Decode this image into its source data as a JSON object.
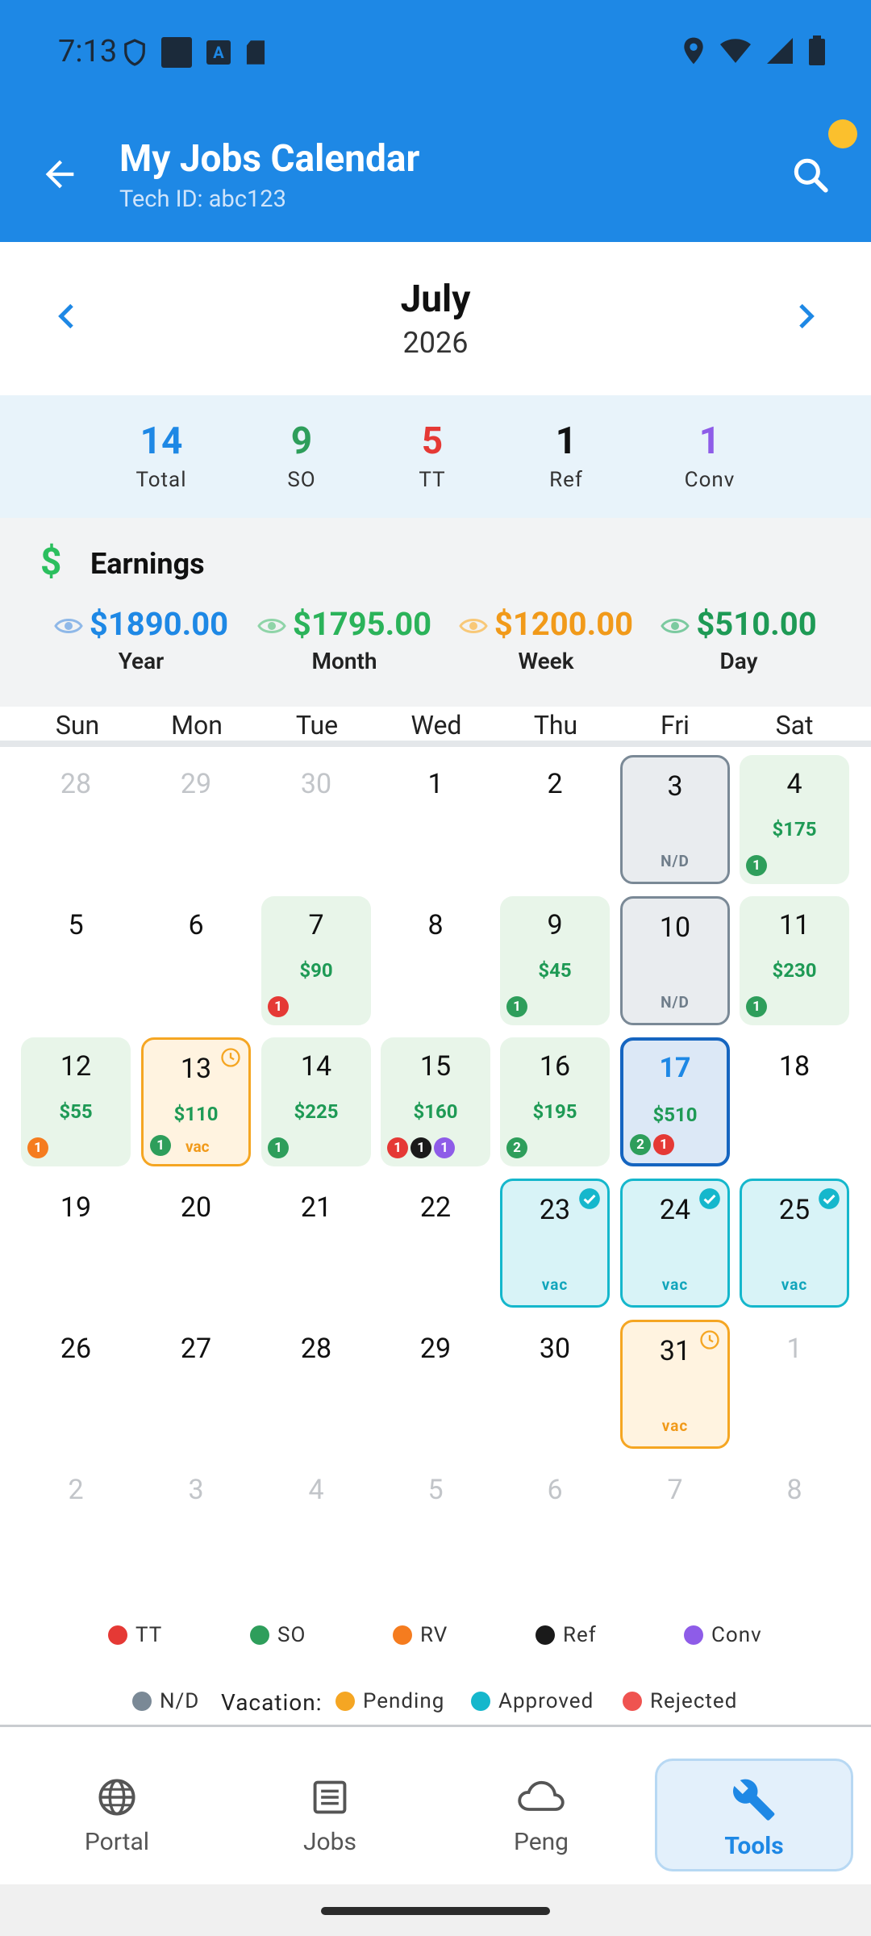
{
  "status_bar": {
    "time": "7:13"
  },
  "app_bar": {
    "title": "My Jobs Calendar",
    "subtitle": "Tech ID: abc123"
  },
  "month_header": {
    "month": "July",
    "year": "2026"
  },
  "stats": [
    {
      "value": "14",
      "label": "Total",
      "color": "#1e88e5"
    },
    {
      "value": "9",
      "label": "SO",
      "color": "#2e9e5b"
    },
    {
      "value": "5",
      "label": "TT",
      "color": "#e53935"
    },
    {
      "value": "1",
      "label": "Ref",
      "color": "#111111"
    },
    {
      "value": "1",
      "label": "Conv",
      "color": "#8e5ce8"
    }
  ],
  "earnings": {
    "title": "Earnings",
    "symbol": "$",
    "items": [
      {
        "amount": "$1890.00",
        "label": "Year",
        "color": "#1e88e5"
      },
      {
        "amount": "$1795.00",
        "label": "Month",
        "color": "#2bb35a"
      },
      {
        "amount": "$1200.00",
        "label": "Week",
        "color": "#f19a1a"
      },
      {
        "amount": "$510.00",
        "label": "Day",
        "color": "#1e9a55"
      }
    ]
  },
  "weekdays": [
    "Sun",
    "Mon",
    "Tue",
    "Wed",
    "Thu",
    "Fri",
    "Sat"
  ],
  "calendar": {
    "days": [
      {
        "day": "28",
        "other": true
      },
      {
        "day": "29",
        "other": true
      },
      {
        "day": "30",
        "other": true
      },
      {
        "day": "1"
      },
      {
        "day": "2"
      },
      {
        "day": "3",
        "status": "nd",
        "tag": "N/D"
      },
      {
        "day": "4",
        "status": "green",
        "amount": "$175",
        "badges": [
          {
            "n": "1",
            "type": "SO"
          }
        ]
      },
      {
        "day": "5"
      },
      {
        "day": "6"
      },
      {
        "day": "7",
        "status": "green",
        "amount": "$90",
        "badges": [
          {
            "n": "1",
            "type": "TT"
          }
        ]
      },
      {
        "day": "8"
      },
      {
        "day": "9",
        "status": "green",
        "amount": "$45",
        "badges": [
          {
            "n": "1",
            "type": "SO"
          }
        ]
      },
      {
        "day": "10",
        "status": "nd",
        "tag": "N/D"
      },
      {
        "day": "11",
        "status": "green",
        "amount": "$230",
        "badges": [
          {
            "n": "1",
            "type": "SO"
          }
        ]
      },
      {
        "day": "12",
        "status": "green",
        "amount": "$55",
        "badges": [
          {
            "n": "1",
            "type": "RV"
          }
        ]
      },
      {
        "day": "13",
        "status": "vacp",
        "amount": "$110",
        "badges": [
          {
            "n": "1",
            "type": "SO"
          }
        ],
        "inline_tag": "vac",
        "corner": "clock"
      },
      {
        "day": "14",
        "status": "green",
        "amount": "$225",
        "badges": [
          {
            "n": "1",
            "type": "SO"
          }
        ]
      },
      {
        "day": "15",
        "status": "green",
        "amount": "$160",
        "badges": [
          {
            "n": "1",
            "type": "TT"
          },
          {
            "n": "1",
            "type": "Ref"
          },
          {
            "n": "1",
            "type": "Conv"
          }
        ]
      },
      {
        "day": "16",
        "status": "green",
        "amount": "$195",
        "badges": [
          {
            "n": "2",
            "type": "SO"
          }
        ]
      },
      {
        "day": "17",
        "status": "today",
        "amount": "$510",
        "badges": [
          {
            "n": "2",
            "type": "SO"
          },
          {
            "n": "1",
            "type": "TT"
          }
        ]
      },
      {
        "day": "18"
      },
      {
        "day": "19"
      },
      {
        "day": "20"
      },
      {
        "day": "21"
      },
      {
        "day": "22"
      },
      {
        "day": "23",
        "status": "vaca",
        "tag": "vac",
        "corner": "check"
      },
      {
        "day": "24",
        "status": "vaca",
        "tag": "vac",
        "corner": "check"
      },
      {
        "day": "25",
        "status": "vaca",
        "tag": "vac",
        "corner": "check"
      },
      {
        "day": "26"
      },
      {
        "day": "27"
      },
      {
        "day": "28"
      },
      {
        "day": "29"
      },
      {
        "day": "30"
      },
      {
        "day": "31",
        "status": "vacp",
        "tag": "vac",
        "corner": "clock"
      },
      {
        "day": "1",
        "other": true
      },
      {
        "day": "2",
        "other": true
      },
      {
        "day": "3",
        "other": true
      },
      {
        "day": "4",
        "other": true
      },
      {
        "day": "5",
        "other": true
      },
      {
        "day": "6",
        "other": true
      },
      {
        "day": "7",
        "other": true
      },
      {
        "day": "8",
        "other": true
      }
    ]
  },
  "badge_colors": {
    "TT": "#e53935",
    "SO": "#2e9e5b",
    "RV": "#f57c1f",
    "Ref": "#1a1a1a",
    "Conv": "#8e5ce8"
  },
  "legend": {
    "types": [
      {
        "label": "TT",
        "color": "#e53935"
      },
      {
        "label": "SO",
        "color": "#2e9e5b"
      },
      {
        "label": "RV",
        "color": "#f57c1f"
      },
      {
        "label": "Ref",
        "color": "#1a1a1a"
      },
      {
        "label": "Conv",
        "color": "#8e5ce8"
      }
    ],
    "nd": {
      "label": "N/D",
      "color": "#7a8996"
    },
    "vacation_label": "Vacation:",
    "vacation": [
      {
        "label": "Pending",
        "color": "#f5a623"
      },
      {
        "label": "Approved",
        "color": "#15b7cc"
      },
      {
        "label": "Rejected",
        "color": "#ef5350"
      }
    ]
  },
  "nav": [
    {
      "label": "Portal",
      "icon": "globe-icon"
    },
    {
      "label": "Jobs",
      "icon": "list-icon"
    },
    {
      "label": "Peng",
      "icon": "cloud-icon"
    },
    {
      "label": "Tools",
      "icon": "wrench-icon",
      "active": true
    }
  ]
}
